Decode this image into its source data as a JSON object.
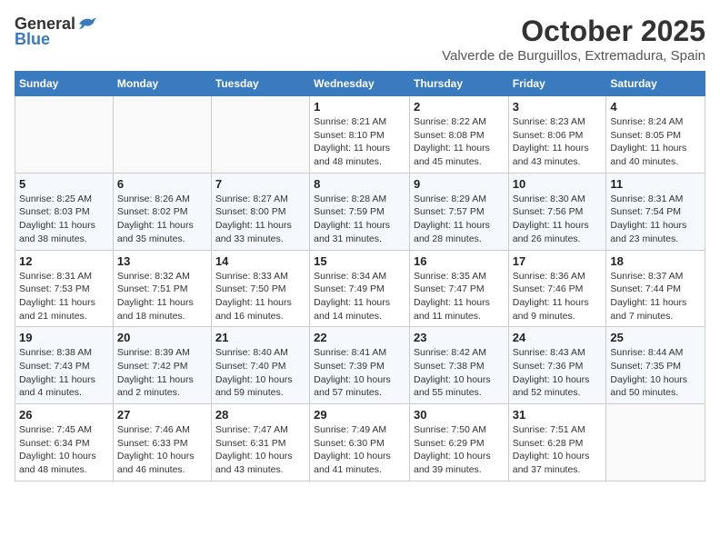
{
  "logo": {
    "general": "General",
    "blue": "Blue"
  },
  "title": "October 2025",
  "location": "Valverde de Burguillos, Extremadura, Spain",
  "weekdays": [
    "Sunday",
    "Monday",
    "Tuesday",
    "Wednesday",
    "Thursday",
    "Friday",
    "Saturday"
  ],
  "weeks": [
    [
      {
        "day": "",
        "info": ""
      },
      {
        "day": "",
        "info": ""
      },
      {
        "day": "",
        "info": ""
      },
      {
        "day": "1",
        "info": "Sunrise: 8:21 AM\nSunset: 8:10 PM\nDaylight: 11 hours and 48 minutes."
      },
      {
        "day": "2",
        "info": "Sunrise: 8:22 AM\nSunset: 8:08 PM\nDaylight: 11 hours and 45 minutes."
      },
      {
        "day": "3",
        "info": "Sunrise: 8:23 AM\nSunset: 8:06 PM\nDaylight: 11 hours and 43 minutes."
      },
      {
        "day": "4",
        "info": "Sunrise: 8:24 AM\nSunset: 8:05 PM\nDaylight: 11 hours and 40 minutes."
      }
    ],
    [
      {
        "day": "5",
        "info": "Sunrise: 8:25 AM\nSunset: 8:03 PM\nDaylight: 11 hours and 38 minutes."
      },
      {
        "day": "6",
        "info": "Sunrise: 8:26 AM\nSunset: 8:02 PM\nDaylight: 11 hours and 35 minutes."
      },
      {
        "day": "7",
        "info": "Sunrise: 8:27 AM\nSunset: 8:00 PM\nDaylight: 11 hours and 33 minutes."
      },
      {
        "day": "8",
        "info": "Sunrise: 8:28 AM\nSunset: 7:59 PM\nDaylight: 11 hours and 31 minutes."
      },
      {
        "day": "9",
        "info": "Sunrise: 8:29 AM\nSunset: 7:57 PM\nDaylight: 11 hours and 28 minutes."
      },
      {
        "day": "10",
        "info": "Sunrise: 8:30 AM\nSunset: 7:56 PM\nDaylight: 11 hours and 26 minutes."
      },
      {
        "day": "11",
        "info": "Sunrise: 8:31 AM\nSunset: 7:54 PM\nDaylight: 11 hours and 23 minutes."
      }
    ],
    [
      {
        "day": "12",
        "info": "Sunrise: 8:31 AM\nSunset: 7:53 PM\nDaylight: 11 hours and 21 minutes."
      },
      {
        "day": "13",
        "info": "Sunrise: 8:32 AM\nSunset: 7:51 PM\nDaylight: 11 hours and 18 minutes."
      },
      {
        "day": "14",
        "info": "Sunrise: 8:33 AM\nSunset: 7:50 PM\nDaylight: 11 hours and 16 minutes."
      },
      {
        "day": "15",
        "info": "Sunrise: 8:34 AM\nSunset: 7:49 PM\nDaylight: 11 hours and 14 minutes."
      },
      {
        "day": "16",
        "info": "Sunrise: 8:35 AM\nSunset: 7:47 PM\nDaylight: 11 hours and 11 minutes."
      },
      {
        "day": "17",
        "info": "Sunrise: 8:36 AM\nSunset: 7:46 PM\nDaylight: 11 hours and 9 minutes."
      },
      {
        "day": "18",
        "info": "Sunrise: 8:37 AM\nSunset: 7:44 PM\nDaylight: 11 hours and 7 minutes."
      }
    ],
    [
      {
        "day": "19",
        "info": "Sunrise: 8:38 AM\nSunset: 7:43 PM\nDaylight: 11 hours and 4 minutes."
      },
      {
        "day": "20",
        "info": "Sunrise: 8:39 AM\nSunset: 7:42 PM\nDaylight: 11 hours and 2 minutes."
      },
      {
        "day": "21",
        "info": "Sunrise: 8:40 AM\nSunset: 7:40 PM\nDaylight: 10 hours and 59 minutes."
      },
      {
        "day": "22",
        "info": "Sunrise: 8:41 AM\nSunset: 7:39 PM\nDaylight: 10 hours and 57 minutes."
      },
      {
        "day": "23",
        "info": "Sunrise: 8:42 AM\nSunset: 7:38 PM\nDaylight: 10 hours and 55 minutes."
      },
      {
        "day": "24",
        "info": "Sunrise: 8:43 AM\nSunset: 7:36 PM\nDaylight: 10 hours and 52 minutes."
      },
      {
        "day": "25",
        "info": "Sunrise: 8:44 AM\nSunset: 7:35 PM\nDaylight: 10 hours and 50 minutes."
      }
    ],
    [
      {
        "day": "26",
        "info": "Sunrise: 7:45 AM\nSunset: 6:34 PM\nDaylight: 10 hours and 48 minutes."
      },
      {
        "day": "27",
        "info": "Sunrise: 7:46 AM\nSunset: 6:33 PM\nDaylight: 10 hours and 46 minutes."
      },
      {
        "day": "28",
        "info": "Sunrise: 7:47 AM\nSunset: 6:31 PM\nDaylight: 10 hours and 43 minutes."
      },
      {
        "day": "29",
        "info": "Sunrise: 7:49 AM\nSunset: 6:30 PM\nDaylight: 10 hours and 41 minutes."
      },
      {
        "day": "30",
        "info": "Sunrise: 7:50 AM\nSunset: 6:29 PM\nDaylight: 10 hours and 39 minutes."
      },
      {
        "day": "31",
        "info": "Sunrise: 7:51 AM\nSunset: 6:28 PM\nDaylight: 10 hours and 37 minutes."
      },
      {
        "day": "",
        "info": ""
      }
    ]
  ]
}
